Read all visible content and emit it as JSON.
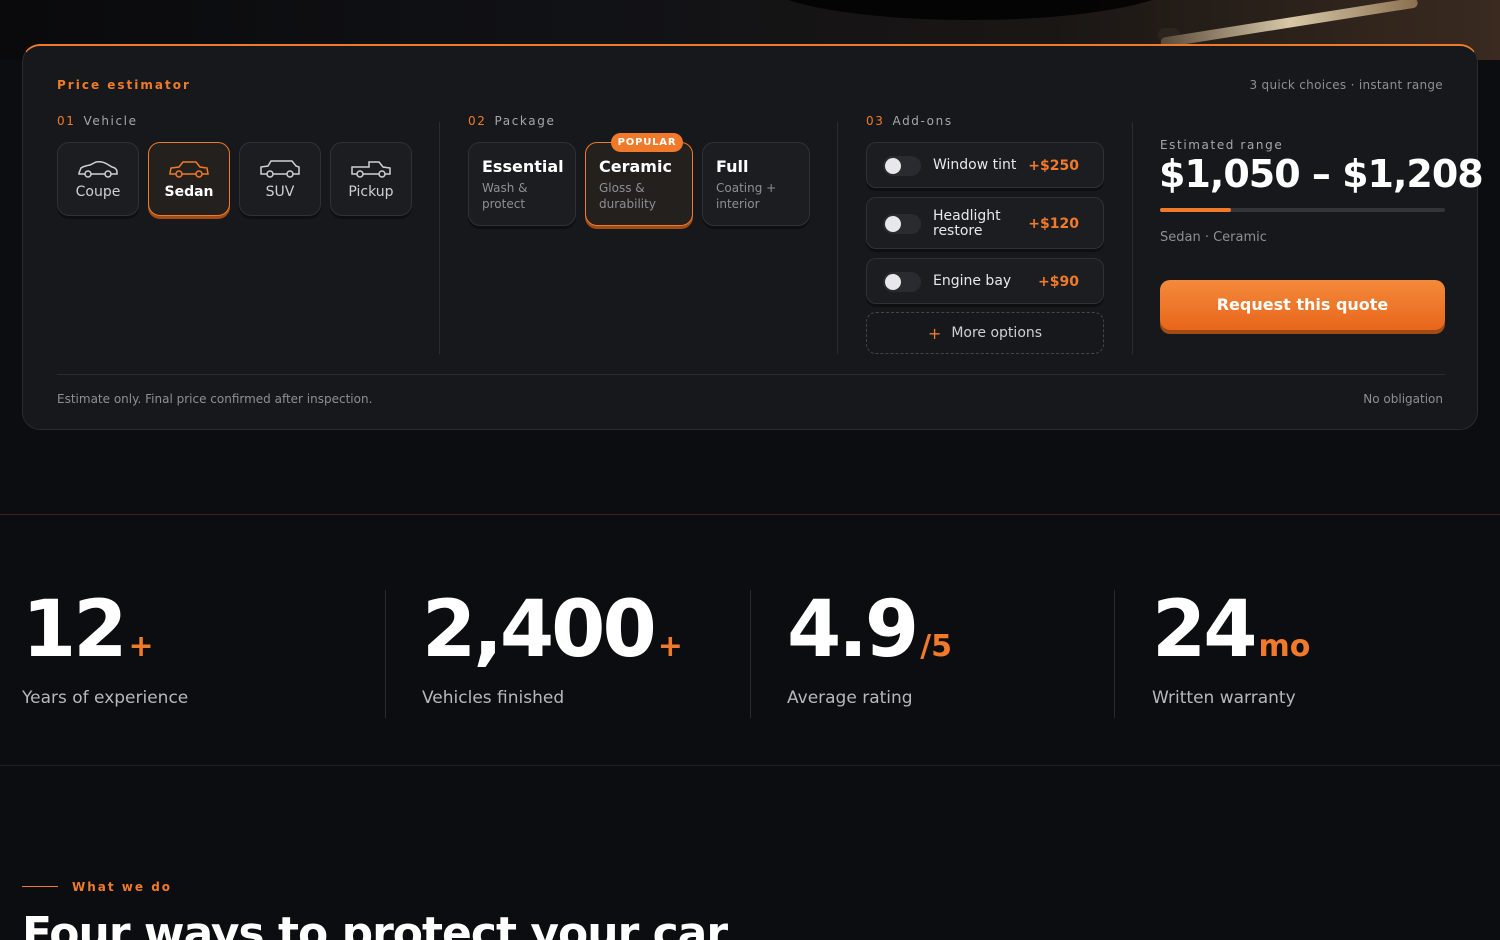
{
  "estimator": {
    "title": "Price estimator",
    "hint": "3 quick choices · instant range",
    "vehicle": {
      "num": "01",
      "label": "Vehicle",
      "options": [
        {
          "label": "Coupe",
          "active": false
        },
        {
          "label": "Sedan",
          "active": true
        },
        {
          "label": "SUV",
          "active": false
        },
        {
          "label": "Pickup",
          "active": false
        }
      ]
    },
    "package": {
      "num": "02",
      "label": "Package",
      "options": [
        {
          "name": "Essential",
          "desc": "Wash & protect",
          "active": false
        },
        {
          "name": "Ceramic",
          "desc": "Gloss & durability",
          "active": true,
          "badge": "POPULAR"
        },
        {
          "name": "Full",
          "desc": "Coating + interior",
          "active": false
        }
      ]
    },
    "addons": {
      "num": "03",
      "label": "Add-ons",
      "items": [
        {
          "name": "Window tint",
          "price": "+$250",
          "enabled": false
        },
        {
          "name": "Headlight restore",
          "price": "+$120",
          "enabled": false
        },
        {
          "name": "Engine bay",
          "price": "+$90",
          "enabled": false
        }
      ],
      "more_label": "More options"
    },
    "range": {
      "label": "Estimated range",
      "value": "$1,050 – $1,208",
      "fill_fraction": 0.25,
      "summary": "Sedan · Ceramic",
      "cta": "Request this quote"
    },
    "disclaimer": "Estimate only. Final price confirmed after inspection.",
    "no_obligation": "No obligation"
  },
  "stats": [
    {
      "value": "12",
      "suffix": "+",
      "label": "Years of experience"
    },
    {
      "value": "2,400",
      "suffix": "+",
      "label": "Vehicles finished"
    },
    {
      "value": "4.9",
      "suffix": "/5",
      "label": "Average rating"
    },
    {
      "value": "24",
      "suffix": "mo",
      "label": "Written warranty"
    }
  ],
  "what_we_do": {
    "label": "What we do",
    "title": "Four ways to protect your car"
  },
  "colors": {
    "accent": "#f07a2a",
    "background": "#0c0d10",
    "card": "#17181b"
  }
}
